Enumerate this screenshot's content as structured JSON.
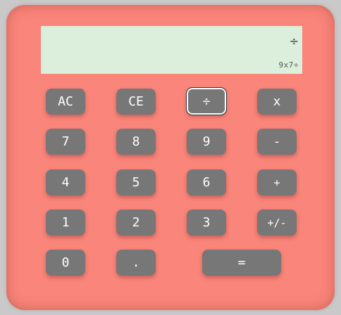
{
  "display": {
    "main": "÷",
    "expression": "9x7÷"
  },
  "keys": {
    "ac": "AC",
    "ce": "CE",
    "divide": "÷",
    "multiply": "x",
    "seven": "7",
    "eight": "8",
    "nine": "9",
    "minus": "-",
    "four": "4",
    "five": "5",
    "six": "6",
    "plus": "+",
    "one": "1",
    "two": "2",
    "three": "3",
    "negate": "+/-",
    "zero": "0",
    "decimal": ".",
    "equals": "="
  },
  "colors": {
    "body": "#fa857a",
    "display": "#dcefdc",
    "button": "#777777",
    "button_text": "#ffffff"
  }
}
